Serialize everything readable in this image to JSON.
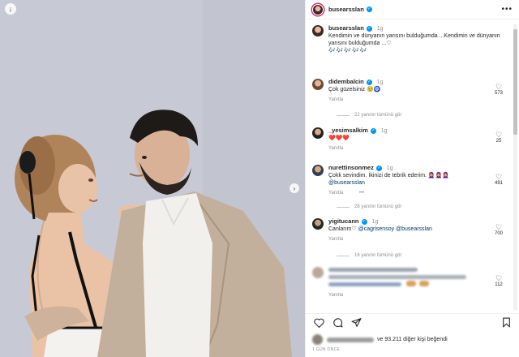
{
  "post": {
    "author": "busearsslan",
    "caption_author": "busearsslan",
    "caption_time": "1g",
    "caption_text": "Kendimin ve dünyanın yarısını bulduğumda ...Kendimin ve dünyanın yarısını bulduğumda ...♡",
    "caption_emojis": "🎶🎶🎶🎶🎶"
  },
  "comments": [
    {
      "user": "didembalcin",
      "time": "1g",
      "text": "Çok güzelsiniz 🥹🧿",
      "likes": "573",
      "reply": "Yanıtla",
      "view_replies": "22 yanıtın tümünü gör"
    },
    {
      "user": "_yesimsalkim",
      "time": "1g",
      "text": "❤️❤️❤️",
      "likes": "25",
      "reply": "Yanıtla",
      "view_replies": ""
    },
    {
      "user": "nurettinsonmez",
      "time": "1g",
      "text": "Çokk sevindim. İkinizi de tebrik ederim. 🧕🧕🧕",
      "mention": "@busearsslan",
      "likes": "491",
      "reply": "Yanıtla",
      "reply_more": "•••",
      "view_replies": "28 yanıtın tümünü gör"
    },
    {
      "user": "yigitucann",
      "time": "1g",
      "text": "Canlarım♡",
      "mention": "@cagrisensoy @busearsslan",
      "likes": "700",
      "reply": "Yanıtla",
      "view_replies": "16 yanıtın tümünü gör"
    },
    {
      "likes": "112",
      "reply": "Yanıtla"
    }
  ],
  "likes_summary": {
    "text": "ve 93.211 diğer kişi beğendi"
  },
  "time_ago": "1 GÜN ÖNCE",
  "icons": {
    "save_bubble": "save-icon",
    "next": "chevron-right-icon",
    "heart": "heart-icon",
    "comment": "comment-icon",
    "share": "share-icon",
    "bookmark": "bookmark-icon",
    "more": "more-icon"
  },
  "colors": {
    "verified": "#0095f6",
    "mention": "#00376b",
    "muted": "#8e8e8e"
  }
}
